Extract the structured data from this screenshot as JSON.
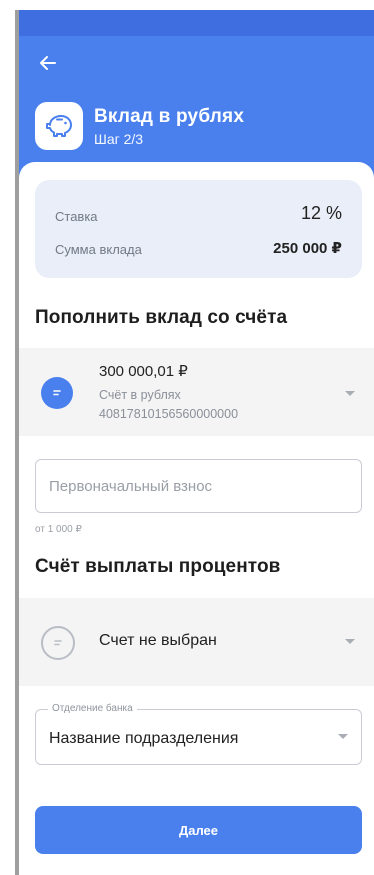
{
  "header": {
    "title": "Вклад в рублях",
    "step": "Шаг 2/3",
    "back_icon": "arrow-left-icon",
    "app_icon": "piggy-bank-icon"
  },
  "summary": {
    "rate_label": "Ставка",
    "rate_value": "12 %",
    "amount_label": "Сумма вклада",
    "amount_value": "250 000 ₽"
  },
  "topup": {
    "section_title": "Пополнить вклад со счёта",
    "account": {
      "balance": "300 000,01 ₽",
      "name": "Счёт в рублях",
      "number": "40817810156560000000",
      "icon": "ruble-coin-icon"
    },
    "initial_payment": {
      "placeholder": "Первоначальный взнос",
      "value": "",
      "hint": "от 1 000 ₽"
    }
  },
  "payout": {
    "section_title": "Счёт выплаты процентов",
    "account_placeholder": "Счет не выбран",
    "branch_label": "Отделение банка",
    "branch_value": "Название подразделения"
  },
  "actions": {
    "next_label": "Далее"
  },
  "colors": {
    "accent": "#4a80ee",
    "status_bar": "#3f6ee0",
    "card_bg": "#e9eef8",
    "row_bg": "#f4f4f5"
  }
}
